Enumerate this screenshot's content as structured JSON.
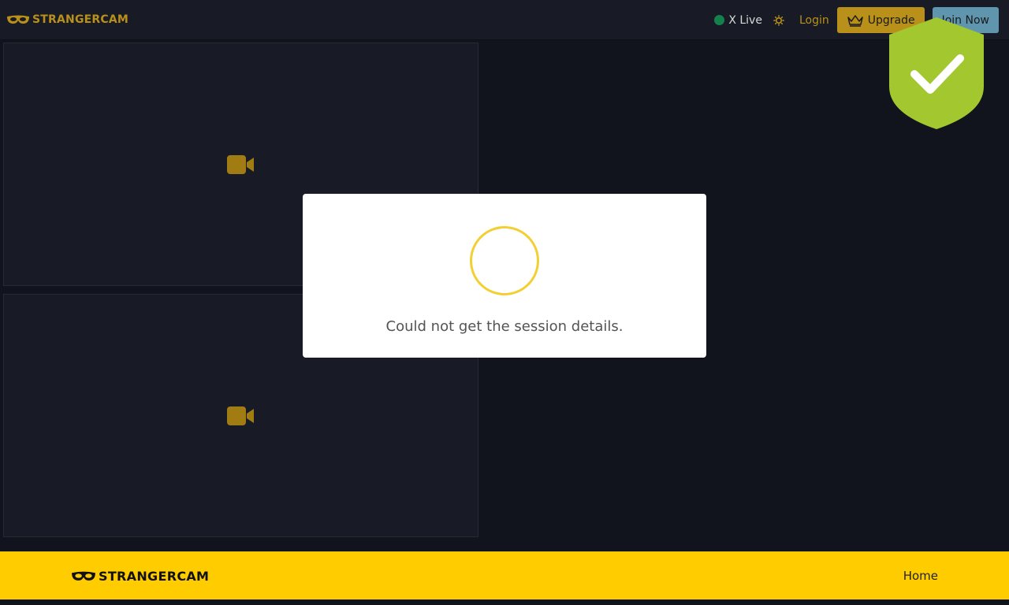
{
  "header": {
    "logo_text": "STRANGERCAM",
    "live_label": "X Live",
    "login_label": "Login",
    "upgrade_label": "Upgrade",
    "join_label": "Join Now"
  },
  "panels": [
    {
      "icon": "video-camera-icon"
    },
    {
      "icon": "video-camera-icon"
    }
  ],
  "modal": {
    "message": "Could not get the session details."
  },
  "footer": {
    "logo_text": "STRANGERCAM",
    "home_label": "Home"
  },
  "colors": {
    "accent": "#b8901a",
    "spinner": "#f2d033",
    "footer_bg": "#ffcc00",
    "live_dot": "#14814d",
    "join_bg": "#5f96ae",
    "shield": "#a2c72f"
  },
  "icons": [
    "mask-icon",
    "sun-icon",
    "crown-icon",
    "video-camera-icon",
    "shield-check-icon",
    "loading-spinner-icon"
  ]
}
